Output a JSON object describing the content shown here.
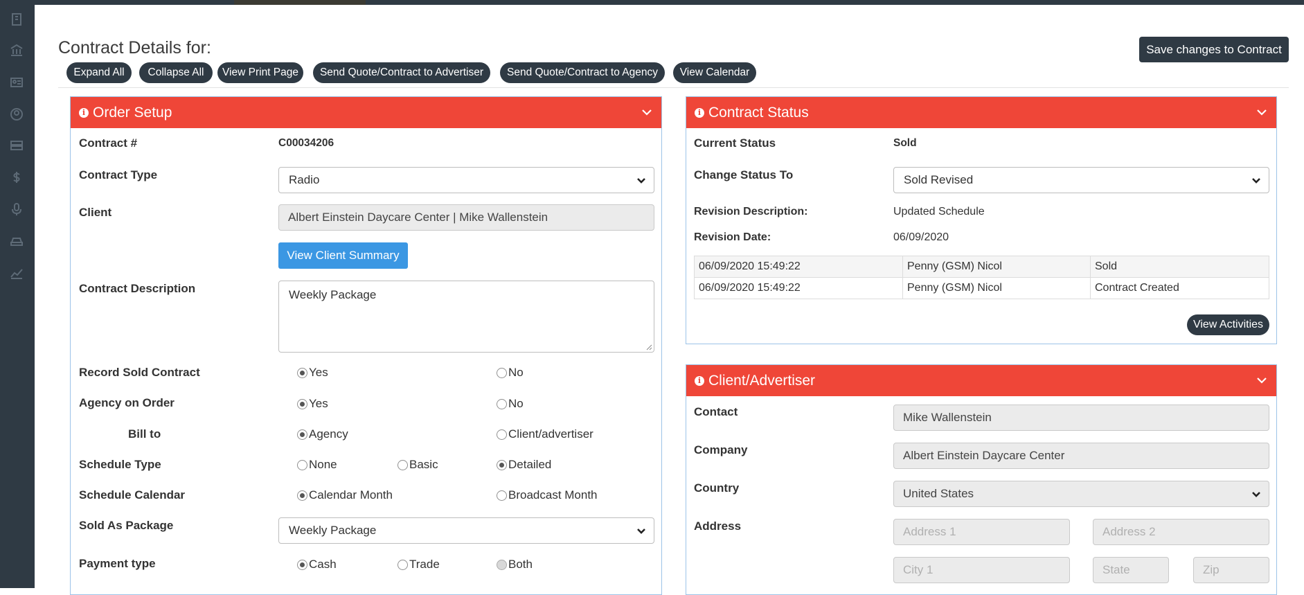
{
  "page": {
    "heading": "Contract Details for:",
    "save_button": "Save changes to Contract"
  },
  "sidebar": {
    "icons": [
      "building-icon",
      "bank-icon",
      "id-card-icon",
      "user-circle-icon",
      "server-icon",
      "dollar-icon",
      "microphone-icon",
      "car-icon",
      "line-chart-icon"
    ]
  },
  "toolbar": {
    "expand_all": "Expand All",
    "collapse_all": "Collapse All",
    "view_print_page": "View Print Page",
    "send_to_advertiser": "Send Quote/Contract to Advertiser",
    "send_to_agency": "Send Quote/Contract to Agency",
    "view_calendar": "View Calendar"
  },
  "order_setup": {
    "title": "Order Setup",
    "contract_number_label": "Contract #",
    "contract_number": "C00034206",
    "contract_type_label": "Contract Type",
    "contract_type": "Radio",
    "client_label": "Client",
    "client": "Albert Einstein Daycare Center | Mike Wallenstein",
    "view_client_summary": "View Client Summary",
    "description_label": "Contract Description",
    "description": "Weekly Package",
    "record_sold_label": "Record Sold Contract",
    "agency_on_order_label": "Agency on Order",
    "bill_to_label": "Bill to",
    "schedule_type_label": "Schedule Type",
    "schedule_calendar_label": "Schedule Calendar",
    "sold_as_package_label": "Sold As Package",
    "sold_as_package": "Weekly Package",
    "payment_type_label": "Payment type",
    "options": {
      "yes": "Yes",
      "no": "No",
      "agency": "Agency",
      "client_advertiser": "Client/advertiser",
      "none": "None",
      "basic": "Basic",
      "detailed": "Detailed",
      "calendar_month": "Calendar Month",
      "broadcast_month": "Broadcast Month",
      "cash": "Cash",
      "trade": "Trade",
      "both": "Both"
    },
    "selected": {
      "record_sold": "Yes",
      "agency_on_order": "Yes",
      "bill_to": "Agency",
      "schedule_type": "Detailed",
      "schedule_calendar": "Calendar Month",
      "payment_type": "Cash"
    }
  },
  "contract_status": {
    "title": "Contract Status",
    "current_status_label": "Current Status",
    "current_status": "Sold",
    "change_status_label": "Change Status To",
    "change_status": "Sold Revised",
    "revision_description_label": "Revision Description:",
    "revision_description": "Updated Schedule",
    "revision_date_label": "Revision Date:",
    "revision_date": "06/09/2020",
    "history": [
      {
        "datetime": "06/09/2020 15:49:22",
        "user": "Penny (GSM) Nicol",
        "action": "Sold"
      },
      {
        "datetime": "06/09/2020 15:49:22",
        "user": "Penny (GSM) Nicol",
        "action": "Contract Created"
      }
    ],
    "view_activities": "View Activities"
  },
  "client_advertiser": {
    "title": "Client/Advertiser",
    "contact_label": "Contact",
    "contact": "Mike Wallenstein",
    "company_label": "Company",
    "company": "Albert Einstein Daycare Center",
    "country_label": "Country",
    "country": "United States",
    "address_label": "Address",
    "address1_placeholder": "Address 1",
    "address2_placeholder": "Address 2",
    "city_placeholder": "City 1",
    "state_placeholder": "State",
    "zip_placeholder": "Zip"
  },
  "colors": {
    "panel_header": "#ef4638",
    "dark": "#2f3a44",
    "primary_button": "#3b97e3"
  }
}
